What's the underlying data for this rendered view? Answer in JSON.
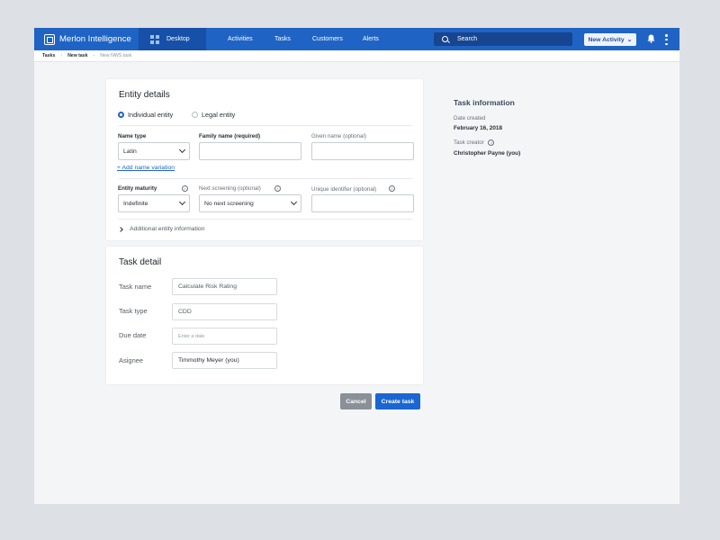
{
  "app": {
    "name": "Merlon Intelligence"
  },
  "nav": {
    "desktop": "Desktop",
    "links": [
      "Activities",
      "Tasks",
      "Customers",
      "Alerts"
    ],
    "search_placeholder": "Search",
    "new_activity": "New Activity"
  },
  "breadcrumb": {
    "items": [
      "Tasks",
      "New task"
    ],
    "current": "New NWS task"
  },
  "entity": {
    "title": "Entity details",
    "type_options": [
      "Individual entity",
      "Legal entity"
    ],
    "name_type_label": "Name type",
    "name_type_value": "Latin",
    "family_name_label": "Family name (required)",
    "given_name_label": "Given name (optional)",
    "add_variation": "+ Add name variation",
    "maturity_label": "Entity maturity",
    "maturity_value": "Indefinite",
    "next_screening_label": "Next screening (optional)",
    "next_screening_value": "No next screening",
    "unique_id_label": "Unique identifier (optional)",
    "additional_info": "Additional entity information"
  },
  "task": {
    "title": "Task detail",
    "name_label": "Task name",
    "name_value": "Calculate Risk Rating",
    "type_label": "Task type",
    "type_value": "CDD",
    "due_label": "Due date",
    "due_placeholder": "Enter a date",
    "assignee_label": "Asignee",
    "assignee_value": "Timmothy Meyer (you)"
  },
  "actions": {
    "cancel": "Cancel",
    "create": "Create task"
  },
  "info": {
    "title": "Task information",
    "date_created_label": "Date created",
    "date_created_value": "February 16, 2018",
    "creator_label": "Task creator",
    "creator_value": "Christopher Payne (you)"
  },
  "colors": {
    "primary": "#1f64c4",
    "nav_dark": "#1650a8",
    "cancel": "#8a9097"
  },
  "icons": [
    "logo-icon",
    "grid-icon",
    "search-icon",
    "chevron-down-icon",
    "bell-icon",
    "kebab-icon",
    "info-icon",
    "chevron-right-icon"
  ]
}
